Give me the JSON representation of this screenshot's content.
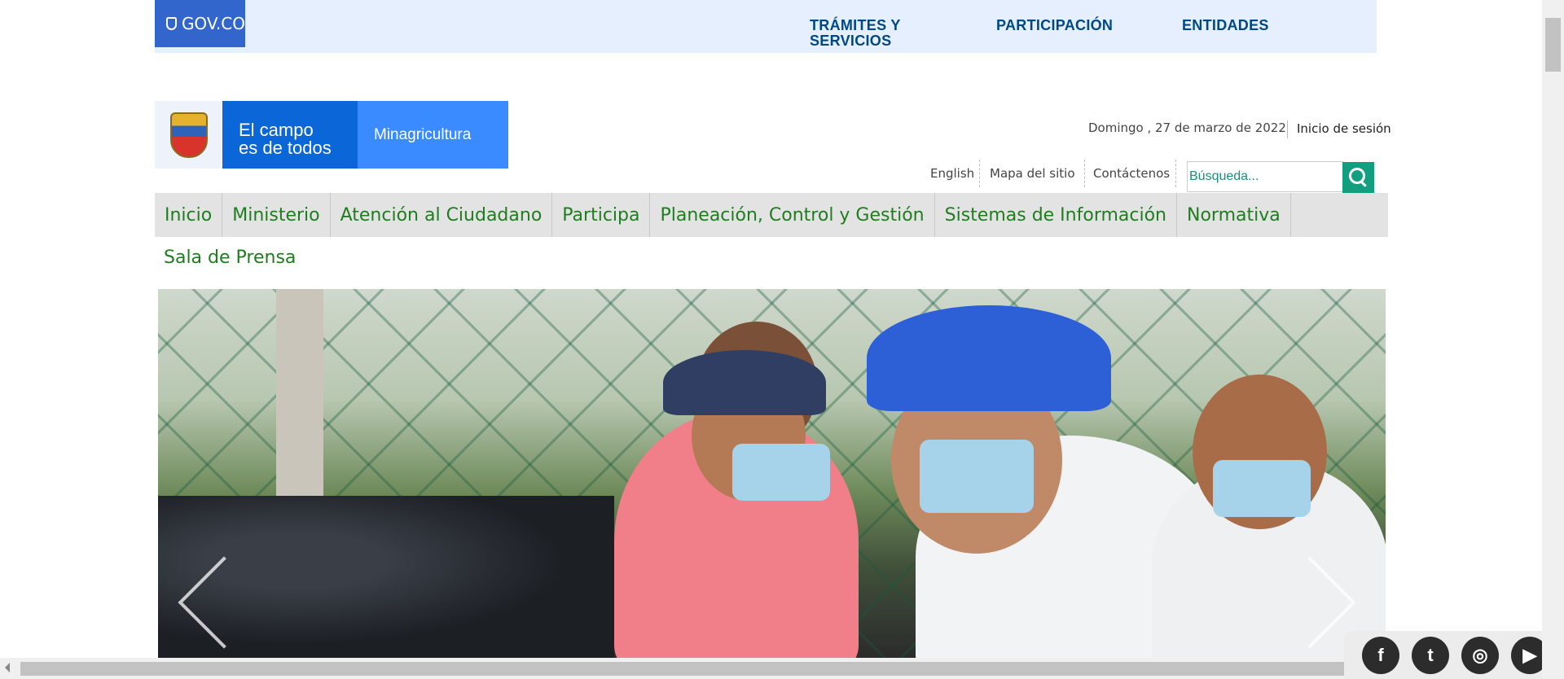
{
  "govbar": {
    "logo_text": "GOV.CO",
    "nav": [
      "TRÁMITES Y SERVICIOS",
      "PARTICIPACIÓN",
      "ENTIDADES"
    ]
  },
  "brand": {
    "slogan_line1": "El campo",
    "slogan_line2": "es de todos",
    "ministry": "Minagricultura"
  },
  "header": {
    "date": "Domingo , 27 de marzo de 2022",
    "login": "Inicio de sesión",
    "links": [
      "English",
      "Mapa del sitio",
      "Contáctenos"
    ],
    "search_placeholder": "Búsqueda..."
  },
  "main_nav": [
    "Inicio",
    "Ministerio",
    "Atención al Ciudadano",
    "Participa",
    "Planeación, Control y Gestión",
    "Sistemas de Información",
    "Normativa"
  ],
  "section_title": "Sala de Prensa",
  "social": [
    {
      "name": "facebook-icon",
      "glyph": "f"
    },
    {
      "name": "twitter-icon",
      "glyph": "t"
    },
    {
      "name": "instagram-icon",
      "glyph": "◎"
    },
    {
      "name": "youtube-icon",
      "glyph": "▶"
    }
  ],
  "colors": {
    "gov_blue": "#3366cc",
    "nav_green": "#1e7e1e",
    "search_button": "#119f80"
  }
}
